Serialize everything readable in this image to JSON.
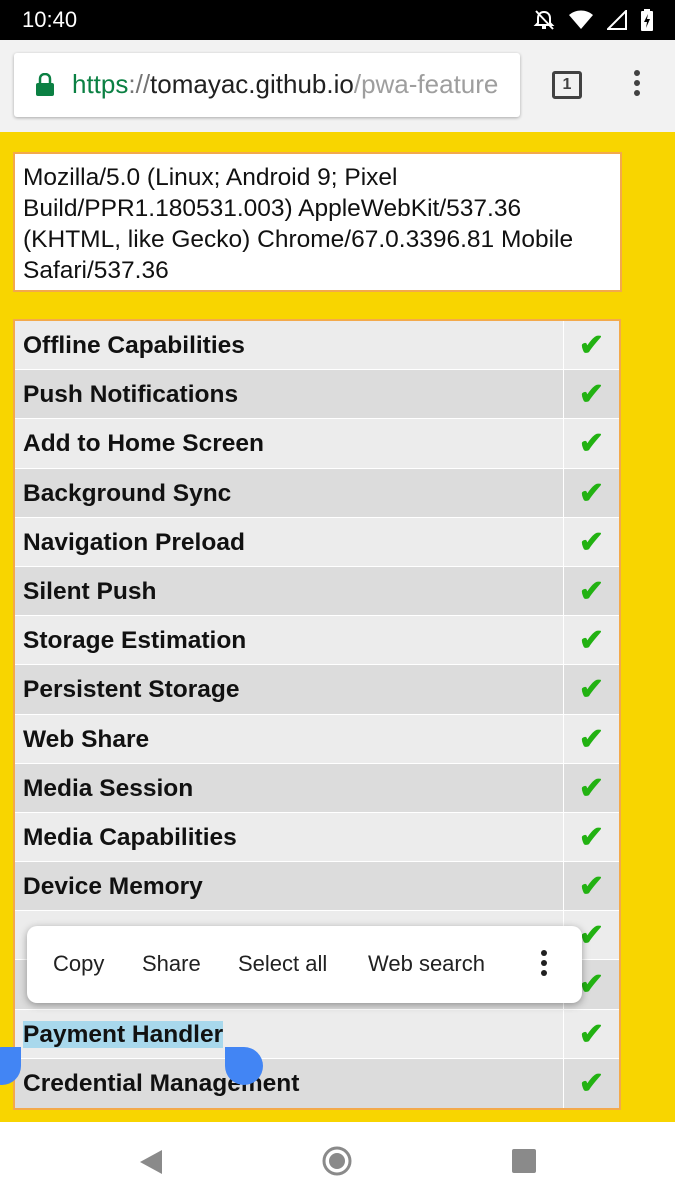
{
  "status_bar": {
    "time": "10:40",
    "icons": [
      "notifications-off-icon",
      "wifi-icon",
      "cell-signal-icon",
      "battery-charging-icon"
    ]
  },
  "browser": {
    "url_scheme": "https",
    "url_sep": "://",
    "url_host": "tomayac.github.io",
    "url_path": "/pwa-feature",
    "tab_count": "1"
  },
  "user_agent": "Mozilla/5.0 (Linux; Android 9; Pixel Build/PPR1.180531.003) AppleWebKit/537.36 (KHTML, like Gecko) Chrome/67.0.3396.81 Mobile Safari/537.36",
  "features": [
    {
      "name": "Offline Capabilities",
      "mark": "✔"
    },
    {
      "name": "Push Notifications",
      "mark": "✔"
    },
    {
      "name": "Add to Home Screen",
      "mark": "✔"
    },
    {
      "name": "Background Sync",
      "mark": "✔"
    },
    {
      "name": "Navigation Preload",
      "mark": "✔"
    },
    {
      "name": "Silent Push",
      "mark": "✔"
    },
    {
      "name": "Storage Estimation",
      "mark": "✔"
    },
    {
      "name": "Persistent Storage",
      "mark": "✔"
    },
    {
      "name": "Web Share",
      "mark": "✔"
    },
    {
      "name": "Media Session",
      "mark": "✔"
    },
    {
      "name": "Media Capabilities",
      "mark": "✔"
    },
    {
      "name": "Device Memory",
      "mark": "✔"
    },
    {
      "name": "",
      "mark": "✔"
    },
    {
      "name": "",
      "mark": "✔"
    },
    {
      "name": "Payment Handler",
      "mark": "✔"
    },
    {
      "name": "Credential Management",
      "mark": "✔"
    }
  ],
  "context_menu": {
    "copy": "Copy",
    "share": "Share",
    "select_all": "Select all",
    "web_search": "Web search"
  },
  "colors": {
    "page_background": "#f8d500",
    "table_border": "#f3a94b",
    "check_green": "#22b212",
    "selection": "#a8d8ec",
    "handle_blue": "#4285f4",
    "url_scheme_green": "#0b8043"
  }
}
